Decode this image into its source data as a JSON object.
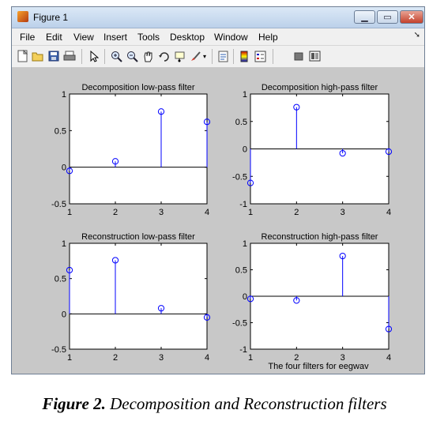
{
  "window": {
    "title": "Figure 1",
    "controls": {
      "minimize": "▁",
      "maximize": "▭",
      "close": "✕"
    }
  },
  "menubar": {
    "items": [
      "File",
      "Edit",
      "View",
      "Insert",
      "Tools",
      "Desktop",
      "Window",
      "Help"
    ]
  },
  "toolbar": {
    "icons": [
      "new-figure-icon",
      "open-file-icon",
      "save-icon",
      "print-icon",
      "edit-plot-arrow-icon",
      "zoom-in-icon",
      "zoom-out-icon",
      "pan-hand-icon",
      "rotate-3d-icon",
      "data-cursor-icon",
      "brush-icon",
      "link-plot-icon",
      "colorbar-icon",
      "legend-icon",
      "hide-plot-tools-icon",
      "show-plot-tools-icon"
    ]
  },
  "figure": {
    "xlabel_bottom": "The four filters for eegwav"
  },
  "caption": {
    "label": "Figure 2.",
    "text": " Decomposition and Reconstruction filters"
  },
  "colors": {
    "stem": "#0000ff",
    "axes_bg": "#ffffff",
    "figure_bg": "#c8c8c8",
    "baseline": "#000000"
  },
  "chart_data": [
    {
      "type": "stem",
      "title": "Decomposition low-pass filter",
      "x": [
        1,
        2,
        3,
        4
      ],
      "y": [
        -0.05,
        0.08,
        0.76,
        0.62
      ],
      "xlim": [
        1,
        4
      ],
      "ylim": [
        -0.5,
        1
      ],
      "xticks": [
        "1",
        "2",
        "3",
        "4"
      ],
      "yticks": [
        "1",
        "0.5",
        "0",
        "-0.5"
      ],
      "ytick_values": [
        1,
        0.5,
        0,
        -0.5
      ]
    },
    {
      "type": "stem",
      "title": "Decomposition high-pass filter",
      "x": [
        1,
        2,
        3,
        4
      ],
      "y": [
        -0.62,
        0.76,
        -0.08,
        -0.05
      ],
      "xlim": [
        1,
        4
      ],
      "ylim": [
        -1,
        1
      ],
      "xticks": [
        "1",
        "2",
        "3",
        "4"
      ],
      "yticks": [
        "1",
        "0.5",
        "0",
        "-0.5",
        "-1"
      ],
      "ytick_values": [
        1,
        0.5,
        0,
        -0.5,
        -1
      ]
    },
    {
      "type": "stem",
      "title": "Reconstruction low-pass filter",
      "x": [
        1,
        2,
        3,
        4
      ],
      "y": [
        0.62,
        0.76,
        0.08,
        -0.05
      ],
      "xlim": [
        1,
        4
      ],
      "ylim": [
        -0.5,
        1
      ],
      "xticks": [
        "1",
        "2",
        "3",
        "4"
      ],
      "yticks": [
        "1",
        "0.5",
        "0",
        "-0.5"
      ],
      "ytick_values": [
        1,
        0.5,
        0,
        -0.5
      ]
    },
    {
      "type": "stem",
      "title": "Reconstruction high-pass filter",
      "x": [
        1,
        2,
        3,
        4
      ],
      "y": [
        -0.05,
        -0.08,
        0.76,
        -0.62
      ],
      "xlim": [
        1,
        4
      ],
      "ylim": [
        -1,
        1
      ],
      "xticks": [
        "1",
        "2",
        "3",
        "4"
      ],
      "yticks": [
        "1",
        "0.5",
        "0",
        "-0.5",
        "-1"
      ],
      "ytick_values": [
        1,
        0.5,
        0,
        -0.5,
        -1
      ]
    }
  ]
}
